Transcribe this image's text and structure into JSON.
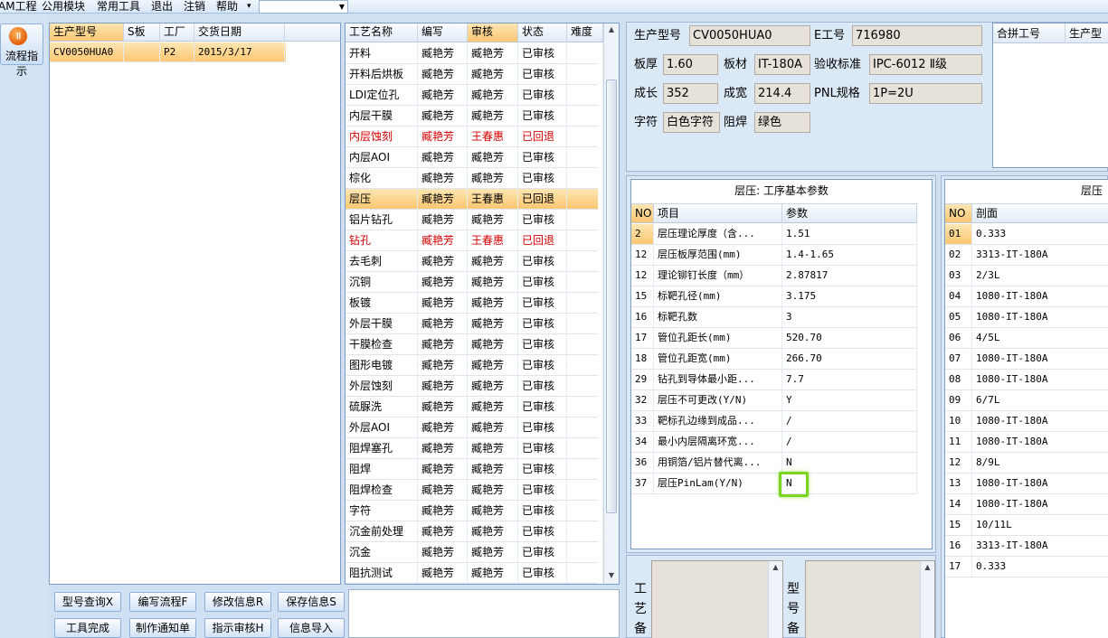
{
  "menu": [
    "AM工程",
    "公用模块",
    "常用工具",
    "退出",
    "注销",
    "帮助"
  ],
  "menu_dropdown_icon": "chevron-down-icon",
  "sidebar": {
    "flow_button": "流程指示"
  },
  "models_grid": {
    "columns": [
      "生产型号",
      "S板",
      "工厂",
      "交货日期"
    ],
    "rows": [
      {
        "model": "CV0050HUA0",
        "s": "",
        "factory": "P2",
        "date": "2015/3/17"
      }
    ]
  },
  "process_grid": {
    "columns": [
      "工艺名称",
      "编写",
      "审核",
      "状态",
      "难度"
    ],
    "rows": [
      {
        "name": "开料",
        "writer": "臧艳芳",
        "reviewer": "臧艳芳",
        "status": "已审核",
        "difficulty": "",
        "flag": ""
      },
      {
        "name": "开料后烘板",
        "writer": "臧艳芳",
        "reviewer": "臧艳芳",
        "status": "已审核",
        "difficulty": "",
        "flag": ""
      },
      {
        "name": "LDI定位孔",
        "writer": "臧艳芳",
        "reviewer": "臧艳芳",
        "status": "已审核",
        "difficulty": "",
        "flag": ""
      },
      {
        "name": "内层干膜",
        "writer": "臧艳芳",
        "reviewer": "臧艳芳",
        "status": "已审核",
        "difficulty": "",
        "flag": ""
      },
      {
        "name": "内层蚀刻",
        "writer": "臧艳芳",
        "reviewer": "王春惠",
        "status": "已回退",
        "difficulty": "",
        "flag": "returned"
      },
      {
        "name": "内层AOI",
        "writer": "臧艳芳",
        "reviewer": "臧艳芳",
        "status": "已审核",
        "difficulty": "",
        "flag": ""
      },
      {
        "name": "棕化",
        "writer": "臧艳芳",
        "reviewer": "臧艳芳",
        "status": "已审核",
        "difficulty": "",
        "flag": ""
      },
      {
        "name": "层压",
        "writer": "臧艳芳",
        "reviewer": "王春惠",
        "status": "已回退",
        "difficulty": "",
        "flag": "selected"
      },
      {
        "name": "铝片钻孔",
        "writer": "臧艳芳",
        "reviewer": "臧艳芳",
        "status": "已审核",
        "difficulty": "",
        "flag": ""
      },
      {
        "name": "钻孔",
        "writer": "臧艳芳",
        "reviewer": "王春惠",
        "status": "已回退",
        "difficulty": "",
        "flag": "returned"
      },
      {
        "name": "去毛刺",
        "writer": "臧艳芳",
        "reviewer": "臧艳芳",
        "status": "已审核",
        "difficulty": "",
        "flag": ""
      },
      {
        "name": "沉铜",
        "writer": "臧艳芳",
        "reviewer": "臧艳芳",
        "status": "已审核",
        "difficulty": "",
        "flag": ""
      },
      {
        "name": "板镀",
        "writer": "臧艳芳",
        "reviewer": "臧艳芳",
        "status": "已审核",
        "difficulty": "",
        "flag": ""
      },
      {
        "name": "外层干膜",
        "writer": "臧艳芳",
        "reviewer": "臧艳芳",
        "status": "已审核",
        "difficulty": "",
        "flag": ""
      },
      {
        "name": "干膜检查",
        "writer": "臧艳芳",
        "reviewer": "臧艳芳",
        "status": "已审核",
        "difficulty": "",
        "flag": ""
      },
      {
        "name": "图形电镀",
        "writer": "臧艳芳",
        "reviewer": "臧艳芳",
        "status": "已审核",
        "difficulty": "",
        "flag": ""
      },
      {
        "name": "外层蚀刻",
        "writer": "臧艳芳",
        "reviewer": "臧艳芳",
        "status": "已审核",
        "difficulty": "",
        "flag": ""
      },
      {
        "name": "硫脲洗",
        "writer": "臧艳芳",
        "reviewer": "臧艳芳",
        "status": "已审核",
        "difficulty": "",
        "flag": ""
      },
      {
        "name": "外层AOI",
        "writer": "臧艳芳",
        "reviewer": "臧艳芳",
        "status": "已审核",
        "difficulty": "",
        "flag": ""
      },
      {
        "name": "阻焊塞孔",
        "writer": "臧艳芳",
        "reviewer": "臧艳芳",
        "status": "已审核",
        "difficulty": "",
        "flag": ""
      },
      {
        "name": "阻焊",
        "writer": "臧艳芳",
        "reviewer": "臧艳芳",
        "status": "已审核",
        "difficulty": "",
        "flag": ""
      },
      {
        "name": "阻焊检查",
        "writer": "臧艳芳",
        "reviewer": "臧艳芳",
        "status": "已审核",
        "difficulty": "",
        "flag": ""
      },
      {
        "name": "字符",
        "writer": "臧艳芳",
        "reviewer": "臧艳芳",
        "status": "已审核",
        "difficulty": "",
        "flag": ""
      },
      {
        "name": "沉金前处理",
        "writer": "臧艳芳",
        "reviewer": "臧艳芳",
        "status": "已审核",
        "difficulty": "",
        "flag": ""
      },
      {
        "name": "沉金",
        "writer": "臧艳芳",
        "reviewer": "臧艳芳",
        "status": "已审核",
        "difficulty": "",
        "flag": ""
      },
      {
        "name": "阻抗测试",
        "writer": "臧艳芳",
        "reviewer": "臧艳芳",
        "status": "已审核",
        "difficulty": "",
        "flag": ""
      }
    ]
  },
  "buttons": {
    "row1": [
      "型号查询X",
      "编写流程F",
      "修改信息R",
      "保存信息S"
    ],
    "row2": [
      "工具完成",
      "制作通知单",
      "指示审核H",
      "信息导入"
    ]
  },
  "info": {
    "fields": [
      {
        "label": "生产型号",
        "value": "CV0050HUA0"
      },
      {
        "label": "E工号",
        "value": "716980"
      },
      {
        "label": "板厚",
        "value": "1.60"
      },
      {
        "label": "板材",
        "value": "IT-180A"
      },
      {
        "label": "验收标准",
        "value": "IPC-6012 Ⅱ级"
      },
      {
        "label": "成长",
        "value": "352"
      },
      {
        "label": "成宽",
        "value": "214.4"
      },
      {
        "label": "PNL规格",
        "value": "1P=2U"
      },
      {
        "label": "字符",
        "value": "白色字符"
      },
      {
        "label": "阻焊",
        "value": "绿色"
      }
    ],
    "merge_columns": [
      "合拼工号",
      "生产型"
    ]
  },
  "params": {
    "title": "层压: 工序基本参数",
    "columns": [
      "NO",
      "项目",
      "参数"
    ],
    "rows": [
      {
        "no": "2",
        "item": "层压理论厚度（含...",
        "value": "1.51",
        "flag": "selected"
      },
      {
        "no": "12",
        "item": "层压板厚范围(mm)",
        "value": "1.4-1.65",
        "flag": ""
      },
      {
        "no": "12",
        "item": "理论铆钉长度（mm）",
        "value": "2.87817",
        "flag": ""
      },
      {
        "no": "15",
        "item": "标靶孔径(mm)",
        "value": "3.175",
        "flag": ""
      },
      {
        "no": "16",
        "item": "标靶孔数",
        "value": "3",
        "flag": ""
      },
      {
        "no": "17",
        "item": "管位孔距长(mm)",
        "value": "520.70",
        "flag": ""
      },
      {
        "no": "18",
        "item": "管位孔距宽(mm)",
        "value": "266.70",
        "flag": ""
      },
      {
        "no": "29",
        "item": "钻孔到导体最小距...",
        "value": "7.7",
        "flag": ""
      },
      {
        "no": "32",
        "item": "层压不可更改(Y/N)",
        "value": "Y",
        "flag": ""
      },
      {
        "no": "33",
        "item": "靶标孔边缘到成品...",
        "value": "/",
        "flag": ""
      },
      {
        "no": "34",
        "item": "最小内层隔离环宽...",
        "value": "/",
        "flag": ""
      },
      {
        "no": "36",
        "item": "用铜箔/铝片替代离...",
        "value": "N",
        "flag": ""
      },
      {
        "no": "37",
        "item": "层压PinLam(Y/N)",
        "value": "N",
        "flag": "focused"
      }
    ]
  },
  "stackup": {
    "title": "层压",
    "columns": [
      "NO",
      "剖面"
    ],
    "rows": [
      {
        "no": "01",
        "value": "0.333"
      },
      {
        "no": "02",
        "value": "3313-IT-180A"
      },
      {
        "no": "03",
        "value": "2/3L"
      },
      {
        "no": "04",
        "value": "1080-IT-180A"
      },
      {
        "no": "05",
        "value": "1080-IT-180A"
      },
      {
        "no": "06",
        "value": "4/5L"
      },
      {
        "no": "07",
        "value": "1080-IT-180A"
      },
      {
        "no": "08",
        "value": "1080-IT-180A"
      },
      {
        "no": "09",
        "value": "6/7L"
      },
      {
        "no": "10",
        "value": "1080-IT-180A"
      },
      {
        "no": "11",
        "value": "1080-IT-180A"
      },
      {
        "no": "12",
        "value": "8/9L"
      },
      {
        "no": "13",
        "value": "1080-IT-180A"
      },
      {
        "no": "14",
        "value": "1080-IT-180A"
      },
      {
        "no": "15",
        "value": "10/11L"
      },
      {
        "no": "16",
        "value": "3313-IT-180A"
      },
      {
        "no": "17",
        "value": "0.333"
      }
    ]
  },
  "remarks": {
    "process_label": "工艺备",
    "model_label": "型号备"
  },
  "colors": {
    "selected_row": "#fbc772",
    "returned_text": "#d40000",
    "focus_border": "#7dd321"
  }
}
